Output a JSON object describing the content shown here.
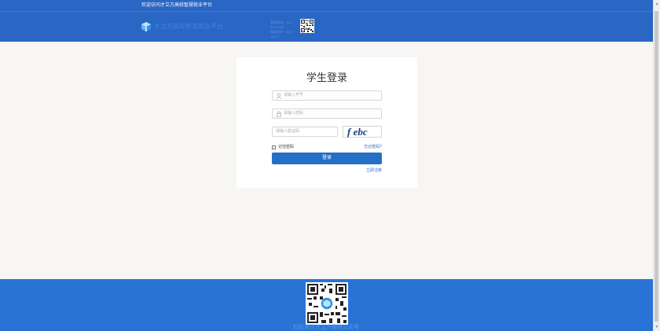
{
  "topbar": {
    "welcome": "欢迎访问才立方高校智慧就业平台"
  },
  "header": {
    "logo_text": "才立方高校智慧就业平台",
    "hotline_lines": [
      "客服热线：400-000-0000",
      "服务时间：9:00-18:00"
    ]
  },
  "login": {
    "title": "学生登录",
    "username_placeholder": "请输入学号",
    "password_placeholder": "请输入密码",
    "captcha_placeholder": "请输入验证码",
    "captcha_text": "f ebc",
    "remember_label": "记住密码",
    "forgot_label": "忘记密码?",
    "login_button": "登录",
    "register_label": "立即注册"
  },
  "footer": {
    "caption": "扫码关注才立方微信公众号"
  },
  "colors": {
    "header_bg": "#2a66c4",
    "footer_bg": "#2a73d6",
    "primary_button": "#2470c6",
    "link": "#2b6ad1"
  },
  "icons": [
    "logo-icon",
    "user-icon",
    "lock-icon",
    "qr-code-icon",
    "checkbox-icon"
  ]
}
